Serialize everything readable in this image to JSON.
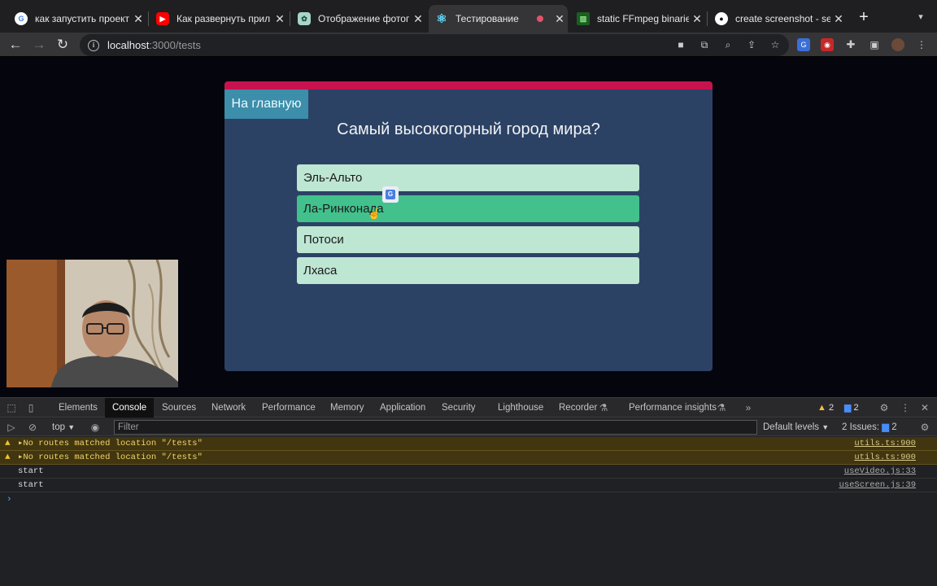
{
  "tabs": [
    {
      "title": "как запустить проект",
      "icon": "google-icon"
    },
    {
      "title": "Как развернуть прил",
      "icon": "youtube-icon"
    },
    {
      "title": "Отображение фотогр",
      "icon": "chatgpt-icon"
    },
    {
      "title": "Тестирование",
      "icon": "react-icon"
    },
    {
      "title": "static FFmpeg binaries",
      "icon": "ffmpeg-icon"
    },
    {
      "title": "create screenshot - se",
      "icon": "github-icon"
    }
  ],
  "address": {
    "host": "localhost",
    "path": ":3000/tests"
  },
  "app": {
    "home_button": "На главную",
    "question": "Самый высокогорный город мира?",
    "answers": [
      "Эль-Альто",
      "Ла-Ринконада",
      "Потоси",
      "Лхаса"
    ]
  },
  "devtools": {
    "tabs": [
      "Elements",
      "Console",
      "Sources",
      "Network",
      "Performance",
      "Memory",
      "Application",
      "Security",
      "Lighthouse",
      "Recorder",
      "Performance insights"
    ],
    "warnings_count": "2",
    "messages_count": "2",
    "context": "top",
    "filter_placeholder": "Filter",
    "levels": "Default levels",
    "issues_label": "2 Issues:",
    "issues_count": "2",
    "console": [
      {
        "type": "warning",
        "text": "No routes matched location \"/tests\"",
        "source": "utils.ts:900"
      },
      {
        "type": "warning",
        "text": "No routes matched location \"/tests\"",
        "source": "utils.ts:900"
      },
      {
        "type": "log",
        "text": "start",
        "source": "useVideo.js:33"
      },
      {
        "type": "log",
        "text": "start",
        "source": "useScreen.js:39"
      }
    ]
  }
}
